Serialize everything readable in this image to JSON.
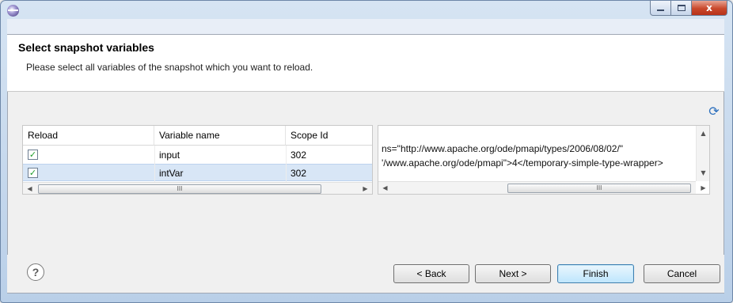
{
  "window": {
    "title": "",
    "controls": {
      "minimize_icon": "minimize-icon",
      "maximize_icon": "maximize-icon",
      "close_label": "x"
    }
  },
  "header": {
    "title": "Select snapshot variables",
    "description": "Please select all variables of the snapshot which you want to reload."
  },
  "toolbar": {
    "refresh_icon": "refresh-icon",
    "refresh_glyph": "⟳"
  },
  "table": {
    "columns": [
      "Reload",
      "Variable name",
      "Scope Id"
    ],
    "rows": [
      {
        "checked": true,
        "checkmark": "✓",
        "name": "input",
        "scope": "302"
      },
      {
        "checked": true,
        "checkmark": "✓",
        "name": "intVar",
        "scope": "302"
      }
    ]
  },
  "detail": {
    "lines": [
      "ns=\"http://www.apache.org/ode/pmapi/types/2006/08/02/\"",
      "'/www.apache.org/ode/pmapi\">4</temporary-simple-type-wrapper>"
    ]
  },
  "scrollbar": {
    "left": "◀",
    "right": "▶",
    "up": "▲",
    "down": "▼",
    "thumb_grip": "III"
  },
  "footer": {
    "help_glyph": "?",
    "buttons": {
      "back": "< Back",
      "next": "Next >",
      "finish": "Finish",
      "cancel": "Cancel"
    }
  }
}
